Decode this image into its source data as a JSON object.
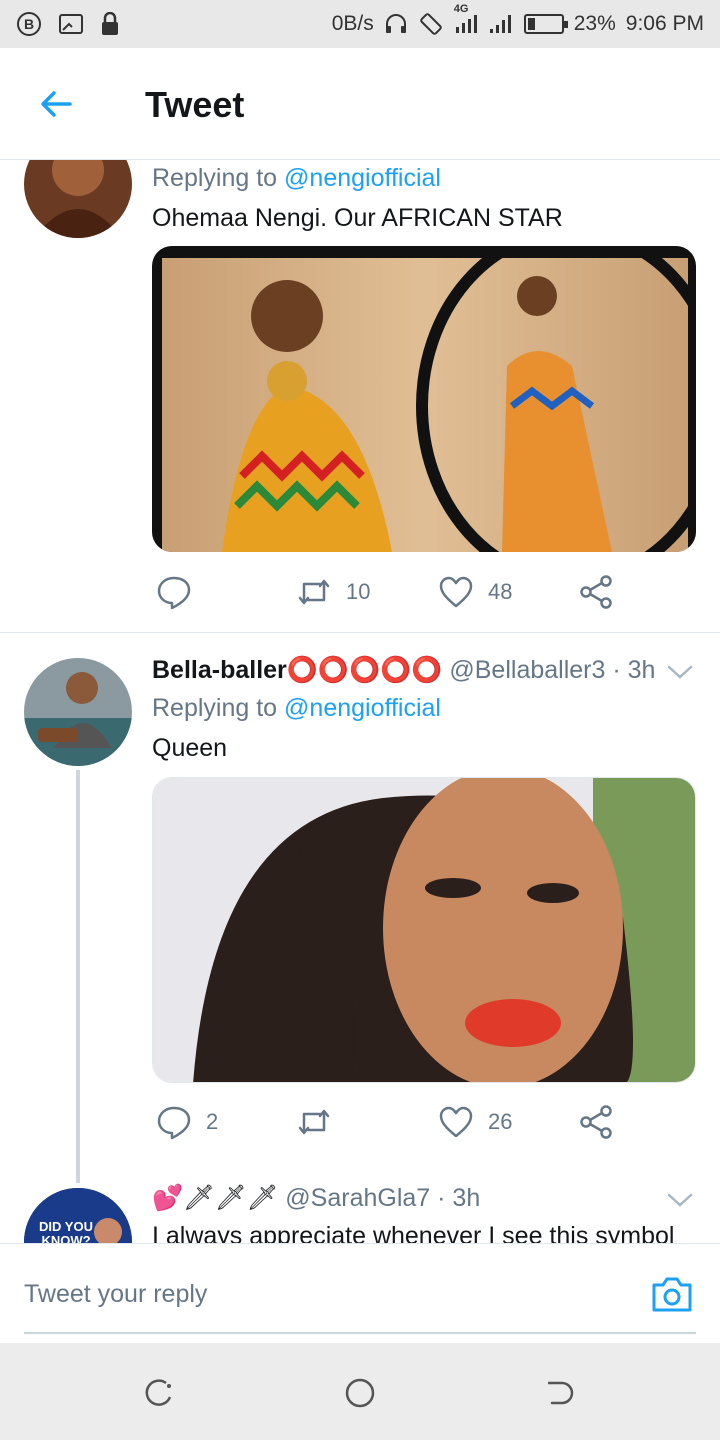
{
  "status_bar": {
    "speed": "0B/s",
    "network": "4G",
    "battery": "23%",
    "battery_level": 0.23,
    "time": "9:06 PM"
  },
  "header": {
    "title": "Tweet"
  },
  "tweets": [
    {
      "replying_label": "Replying to",
      "replying_handle": "@nengiofficial",
      "text": "Ohemaa Nengi. Our AFRICAN STAR",
      "replies": "",
      "retweets": "10",
      "likes": "48"
    },
    {
      "name": "Bella-baller⭕⭕⭕⭕⭕",
      "handle": "@Bellaballer3",
      "time": "· 3h",
      "replying_label": "Replying to",
      "replying_handle": "@nengiofficial",
      "text": "Queen",
      "replies": "2",
      "retweets": "",
      "likes": "26"
    },
    {
      "name_emoji": "💕🗡🗡🗡",
      "handle": "@SarahGla7",
      "time": "· 3h",
      "text": "I always appreciate whenever I see this symbol",
      "avatar_text": "DID YOU KNOW?"
    }
  ],
  "reply_bar": {
    "placeholder": "Tweet your reply"
  },
  "colors": {
    "accent": "#1da1f2",
    "secondary_text": "#657786",
    "divider": "#e1e8ed"
  },
  "icons": [
    "back-arrow-icon",
    "reply-icon",
    "retweet-icon",
    "like-icon",
    "share-icon",
    "chevron-down-icon",
    "camera-icon"
  ]
}
